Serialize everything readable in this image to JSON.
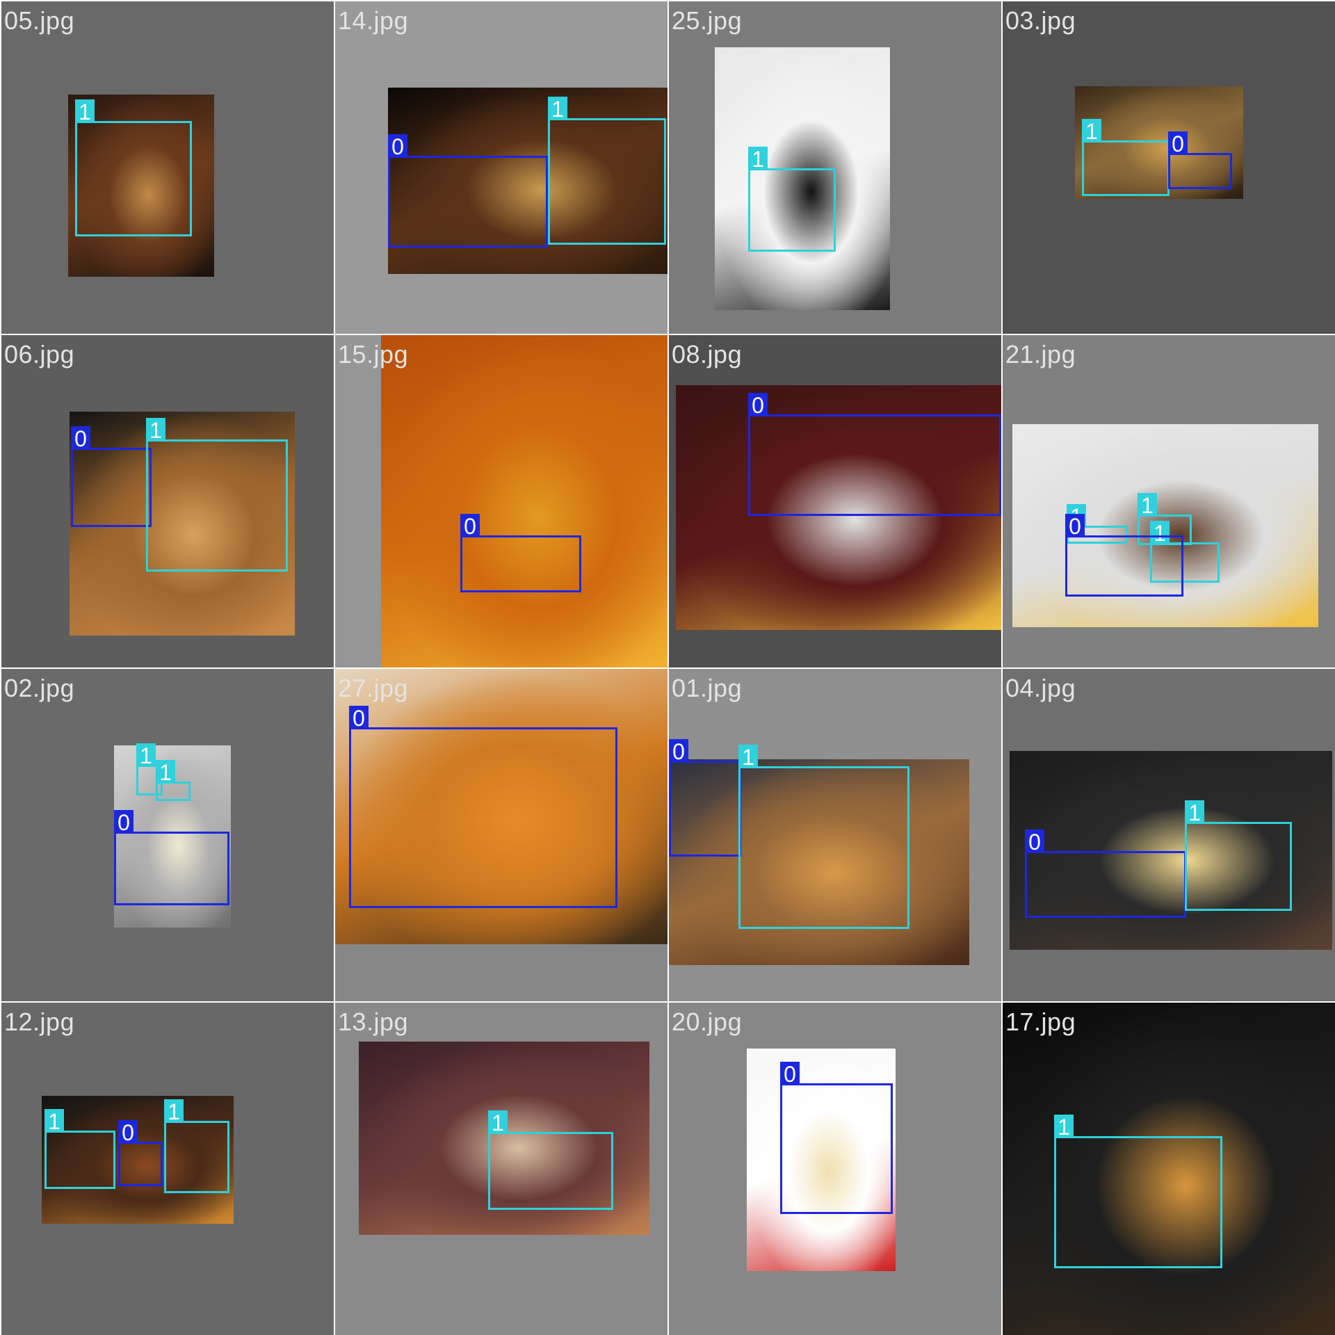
{
  "mosaic": {
    "tiles": [
      {
        "filename": "05.jpg",
        "bg": "#696969",
        "photo": {
          "colors": [
            "#2a1810",
            "#6b3a1c",
            "#c08a4a",
            "#1a120c"
          ]
        },
        "boxes": [
          {
            "cls": "1"
          }
        ]
      },
      {
        "filename": "14.jpg",
        "bg": "#9a9a9a",
        "photo": {
          "colors": [
            "#0c0806",
            "#5a3218",
            "#c99a50",
            "#2d1a0c"
          ]
        },
        "boxes": [
          {
            "cls": "0"
          },
          {
            "cls": "1"
          }
        ]
      },
      {
        "filename": "25.jpg",
        "bg": "#7b7b7b",
        "photo": {
          "colors": [
            "#e8e8e8",
            "#f3f3f3",
            "#111111",
            "#1b1b1b"
          ]
        },
        "boxes": [
          {
            "cls": "1"
          }
        ]
      },
      {
        "filename": "03.jpg",
        "bg": "#525252",
        "photo": {
          "colors": [
            "#3a2a18",
            "#8a6a3a",
            "#d1a050",
            "#2a1c10"
          ]
        },
        "boxes": [
          {
            "cls": "1"
          },
          {
            "cls": "0"
          }
        ]
      },
      {
        "filename": "06.jpg",
        "bg": "#5d5d5d",
        "photo": {
          "colors": [
            "#141414",
            "#a06830",
            "#d6a25e",
            "#c98a4a"
          ]
        },
        "boxes": [
          {
            "cls": "0"
          },
          {
            "cls": "1"
          }
        ]
      },
      {
        "filename": "15.jpg",
        "bg": "#969696",
        "photo": {
          "colors": [
            "#b84f0a",
            "#d06a10",
            "#e29a20",
            "#f2b030"
          ]
        },
        "boxes": [
          {
            "cls": "0"
          }
        ]
      },
      {
        "filename": "08.jpg",
        "bg": "#4f4f4f",
        "photo": {
          "colors": [
            "#3a1414",
            "#5a1818",
            "#e3e3e3",
            "#f2c040"
          ]
        },
        "boxes": [
          {
            "cls": "0"
          }
        ]
      },
      {
        "filename": "21.jpg",
        "bg": "#808080",
        "photo": {
          "colors": [
            "#eaeaea",
            "#dedede",
            "#5a3a24",
            "#f0c040"
          ]
        },
        "boxes": [
          {
            "cls": "1"
          },
          {
            "cls": "1"
          },
          {
            "cls": "1"
          },
          {
            "cls": "0"
          }
        ]
      },
      {
        "filename": "02.jpg",
        "bg": "#6a6a6a",
        "photo": {
          "colors": [
            "#d4d4d4",
            "#b0b0b0",
            "#f0ead0",
            "#707070"
          ]
        },
        "boxes": [
          {
            "cls": "1"
          },
          {
            "cls": "1"
          },
          {
            "cls": "0"
          }
        ]
      },
      {
        "filename": "27.jpg",
        "bg": "#878787",
        "photo": {
          "colors": [
            "#e6d6c0",
            "#d07a20",
            "#e88a2a",
            "#3a2a1a"
          ]
        },
        "boxes": [
          {
            "cls": "0"
          }
        ]
      },
      {
        "filename": "01.jpg",
        "bg": "#8f8f8f",
        "photo": {
          "colors": [
            "#2a3040",
            "#9a6a3a",
            "#d89a4a",
            "#4a2a18"
          ]
        },
        "boxes": [
          {
            "cls": "0"
          },
          {
            "cls": "1"
          }
        ]
      },
      {
        "filename": "04.jpg",
        "bg": "#6f6f6f",
        "photo": {
          "colors": [
            "#1c1c1c",
            "#2a2a2a",
            "#f0d890",
            "#5a4030"
          ]
        },
        "boxes": [
          {
            "cls": "0"
          },
          {
            "cls": "1"
          }
        ]
      },
      {
        "filename": "12.jpg",
        "bg": "#686868",
        "photo": {
          "colors": [
            "#141414",
            "#4a2a18",
            "#8a4a20",
            "#d08a30"
          ]
        },
        "boxes": [
          {
            "cls": "1"
          },
          {
            "cls": "0"
          },
          {
            "cls": "1"
          }
        ]
      },
      {
        "filename": "13.jpg",
        "bg": "#8a8a8a",
        "photo": {
          "colors": [
            "#3a2028",
            "#6a3a3a",
            "#d8c0a0",
            "#c08050"
          ]
        },
        "boxes": [
          {
            "cls": "1"
          }
        ]
      },
      {
        "filename": "20.jpg",
        "bg": "#878787",
        "photo": {
          "colors": [
            "#f7f7f7",
            "#ffffff",
            "#f0e0b0",
            "#d02020"
          ]
        },
        "boxes": [
          {
            "cls": "0"
          }
        ]
      },
      {
        "filename": "17.jpg",
        "bg": "#0e0e0e",
        "photo": {
          "colors": [
            "#0a0a0a",
            "#1e1e1e",
            "#d8963c",
            "#3a2a1c"
          ]
        },
        "boxes": [
          {
            "cls": "1"
          }
        ]
      }
    ]
  }
}
